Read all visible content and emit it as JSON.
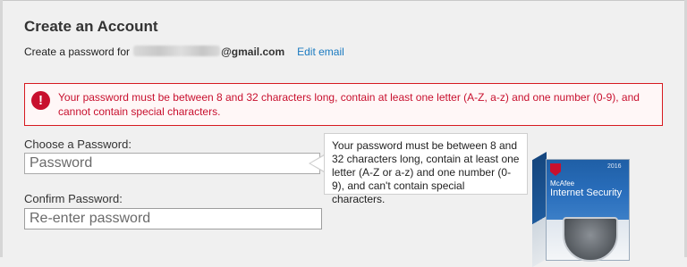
{
  "page": {
    "title": "Create an Account",
    "password_prompt": "Create a password for",
    "email_domain": "@gmail.com",
    "edit_email_label": "Edit email"
  },
  "error": {
    "icon": "exclamation-icon",
    "message": "Your password must be between 8 and 32 characters long, contain at least one letter (A-Z, a-z) and one number (0-9), and cannot contain special characters."
  },
  "form": {
    "password_label": "Choose a Password:",
    "password_placeholder": "Password",
    "password_value": "",
    "confirm_label": "Confirm Password:",
    "confirm_placeholder": "Re-enter password",
    "confirm_value": ""
  },
  "tooltip": {
    "text": "Your password must be between 8 and 32 characters long, contain at least one letter (A-Z or a-z) and one number (0-9), and can't contain special characters."
  },
  "product": {
    "year": "2016",
    "brand": "McAfee",
    "name": "Internet Security"
  },
  "colors": {
    "error_red": "#c8102e",
    "link_blue": "#1a7ac0",
    "background": "#f0f0f0"
  }
}
